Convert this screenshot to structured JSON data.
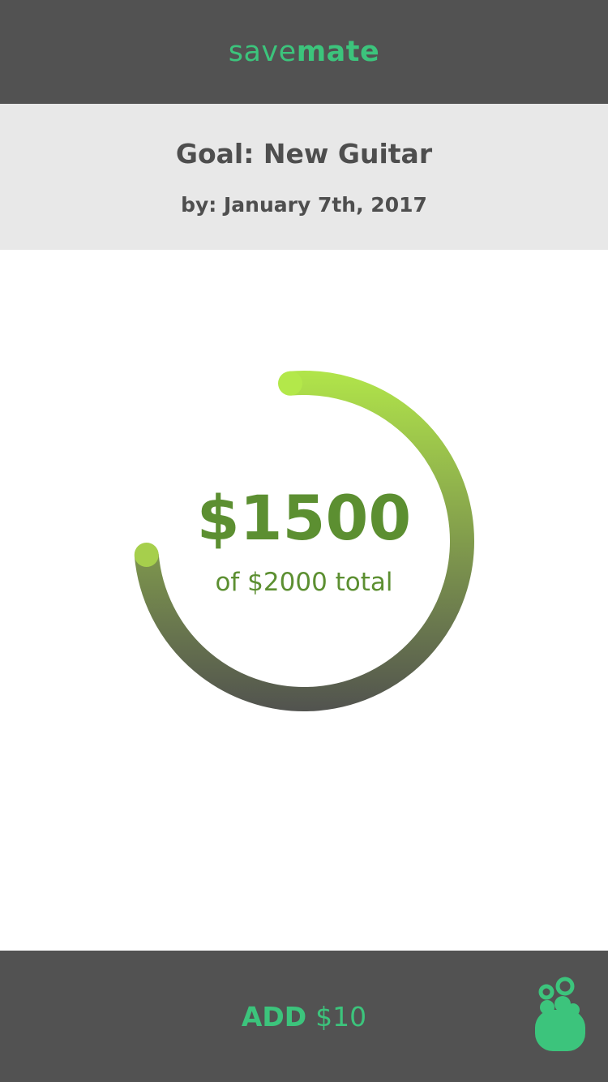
{
  "app": {
    "name_light": "save",
    "name_bold": "mate",
    "accent_color": "#3cc47c"
  },
  "goal": {
    "title": "Goal: New Guitar",
    "deadline": "by: January 7th, 2017"
  },
  "progress": {
    "saved_label": "$1500",
    "total_label": "of $2000 total",
    "saved": 1500,
    "total": 2000,
    "ring_gradient": [
      "#b3e84a",
      "#4f4f4f"
    ]
  },
  "action": {
    "add_word": "ADD",
    "add_amount": "$10"
  },
  "icons": {
    "mascot": "bubble-mascot-icon"
  }
}
